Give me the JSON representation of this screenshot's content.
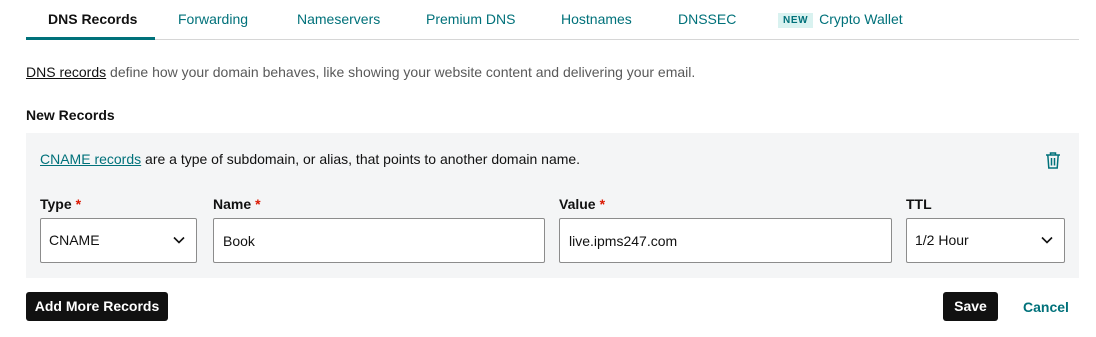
{
  "tabs": [
    {
      "label": "DNS Records",
      "active": true
    },
    {
      "label": "Forwarding"
    },
    {
      "label": "Nameservers"
    },
    {
      "label": "Premium DNS"
    },
    {
      "label": "Hostnames"
    },
    {
      "label": "DNSSEC"
    },
    {
      "label": "Crypto Wallet",
      "badge": "NEW"
    }
  ],
  "intro": {
    "link_text": "DNS records",
    "rest": " define how your domain behaves, like showing your website content and delivering your email."
  },
  "section_title": "New Records",
  "record": {
    "description_link": "CNAME records",
    "description_rest": " are a type of subdomain, or alias, that points to another domain name.",
    "trash_icon": "trash-icon",
    "fields": {
      "type": {
        "label": "Type",
        "required_mark": "*",
        "value": "CNAME"
      },
      "name": {
        "label": "Name",
        "required_mark": "*",
        "value": "Book"
      },
      "value": {
        "label": "Value",
        "required_mark": "*",
        "value": "live.ipms247.com"
      },
      "ttl": {
        "label": "TTL",
        "value": "1/2 Hour"
      }
    }
  },
  "actions": {
    "add_more": "Add More Records",
    "save": "Save",
    "cancel": "Cancel"
  },
  "colors": {
    "accent": "#00717a",
    "required": "#db1802",
    "primary_button": "#111111",
    "panel_background": "#f4f5f6"
  }
}
